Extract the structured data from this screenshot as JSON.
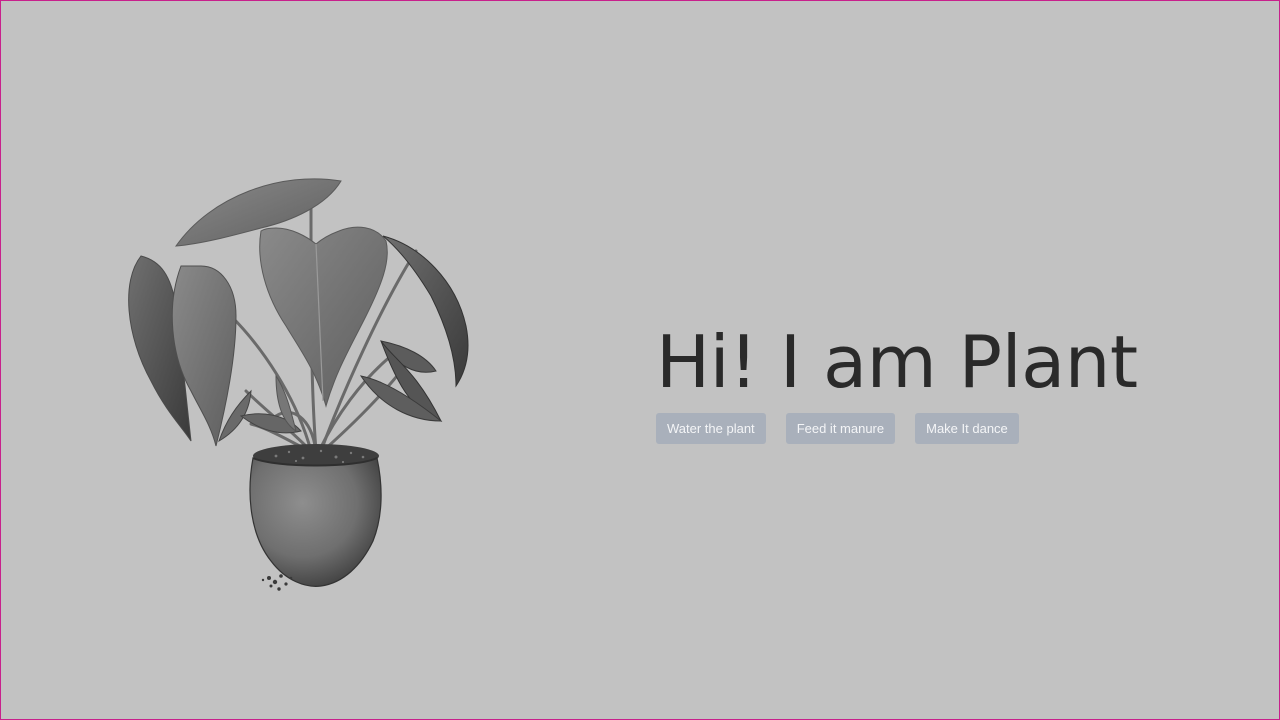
{
  "hero": {
    "title": "Hi! I am Plant",
    "buttons": [
      {
        "label": "Water the plant"
      },
      {
        "label": "Feed it manure"
      },
      {
        "label": "Make It dance"
      }
    ]
  },
  "colors": {
    "background": "#c2c2c2",
    "title": "#2a2a2a",
    "button_bg": "#a9b0bb",
    "button_text": "#f4f5f7",
    "frame_border": "#c8208c"
  }
}
